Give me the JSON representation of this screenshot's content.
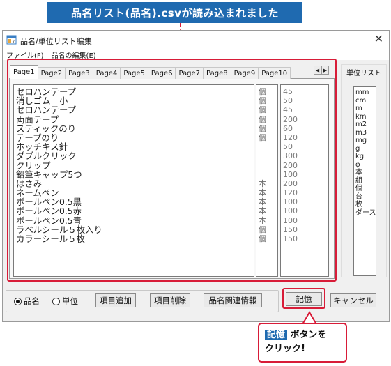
{
  "annotation": {
    "banner_text": "品名リスト(品名).csvが読み込まれました",
    "callout_tag": "記憶",
    "callout_line1": "ボタンを",
    "callout_line2": "クリック!",
    "accent_color": "#1f6ab0",
    "highlight_color": "#d81c38"
  },
  "window": {
    "title": "品名/単位リスト編集",
    "close_icon": "close-icon"
  },
  "menu": {
    "items": [
      "ファイル(F)",
      "品名の編集(E)"
    ]
  },
  "tabs": [
    "Page1",
    "Page2",
    "Page3",
    "Page4",
    "Page5",
    "Page6",
    "Page7",
    "Page8",
    "Page9",
    "Page10"
  ],
  "active_tab": "Page1",
  "items": [
    {
      "name": "セロハンテープ",
      "unit": "個",
      "qty": "45"
    },
    {
      "name": "消しゴム　小",
      "unit": "個",
      "qty": "50"
    },
    {
      "name": "セロハンテープ",
      "unit": "個",
      "qty": "45"
    },
    {
      "name": "両面テープ",
      "unit": "個",
      "qty": "200"
    },
    {
      "name": "スティックのり",
      "unit": "個",
      "qty": "60"
    },
    {
      "name": "テープのり",
      "unit": "個",
      "qty": "120"
    },
    {
      "name": "ホッチキス針",
      "unit": "",
      "qty": "50"
    },
    {
      "name": "ダブルクリック",
      "unit": "",
      "qty": "300"
    },
    {
      "name": "クリップ",
      "unit": "",
      "qty": "200"
    },
    {
      "name": "鉛筆キャップ5つ",
      "unit": "",
      "qty": "100"
    },
    {
      "name": "はさみ",
      "unit": "本",
      "qty": "200"
    },
    {
      "name": "ネームペン",
      "unit": "本",
      "qty": "120"
    },
    {
      "name": "ボールペン0.5黒",
      "unit": "本",
      "qty": "100"
    },
    {
      "name": "ボールペン0.5赤",
      "unit": "本",
      "qty": "100"
    },
    {
      "name": "ボールペン0.5青",
      "unit": "本",
      "qty": "100"
    },
    {
      "name": "ラベルシール５枚入り",
      "unit": "個",
      "qty": "150"
    },
    {
      "name": "カラーシール５枚",
      "unit": "個",
      "qty": "150"
    }
  ],
  "unit_list": {
    "title": "単位リスト",
    "units": [
      "mm",
      "cm",
      "m",
      "km",
      "m2",
      "m3",
      "mg",
      "g",
      "kg",
      "φ",
      "本",
      "組",
      "個",
      "台",
      "枚",
      "ダース"
    ]
  },
  "bottom": {
    "radio_name": "品名",
    "radio_unit": "単位",
    "selected": "品名",
    "btn_add": "項目追加",
    "btn_delete": "項目削除",
    "btn_related": "品名関連情報",
    "btn_memory": "記憶",
    "btn_cancel": "キャンセル"
  }
}
